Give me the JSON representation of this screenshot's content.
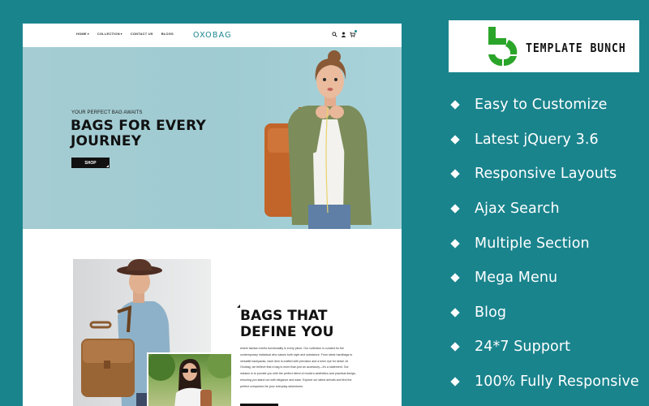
{
  "site": {
    "nav": [
      {
        "label": "HOME",
        "has_dropdown": true
      },
      {
        "label": "COLLECTION",
        "has_dropdown": true
      },
      {
        "label": "CONTACT US",
        "has_dropdown": false
      },
      {
        "label": "BLOGS",
        "has_dropdown": false
      }
    ],
    "logo": "OXOBAG",
    "icons": [
      "search-icon",
      "user-icon",
      "cart-icon"
    ],
    "hero": {
      "kicker": "YOUR PERFECT BAG AWAITS",
      "title": "BAGS FOR EVERY JOURNEY",
      "button": "SHOP"
    },
    "about": {
      "title": "BAGS THAT DEFINE YOU",
      "body": "where fashion meets functionality in every piece. Our collection is curated for the contemporary individual who values both style and substance. From sleek handbags to versatile backpacks, each item is crafted with precision and a keen eye for detail. At Oxobag, we believe that a bag is more than just an accessory—it's a statement. Our mission is to provide you with the perfect blend of modern aesthetics and practical design, ensuring you stand out with elegance and ease. Explore our latest arrivals and find the perfect companion for your everyday adventures."
    }
  },
  "brand": {
    "name": "TEMPLATE BUNCH",
    "color": "#2aa52a"
  },
  "features": [
    "Easy to Customize",
    "Latest jQuery 3.6",
    "Responsive Layouts",
    "Ajax Search",
    "Multiple Section",
    "Mega Menu",
    "Blog",
    "24*7 Support",
    "100% Fully Responsive"
  ],
  "colors": {
    "background": "#1a848d",
    "hero_bg": "#a4ccd2",
    "accent": "#1a848d"
  }
}
